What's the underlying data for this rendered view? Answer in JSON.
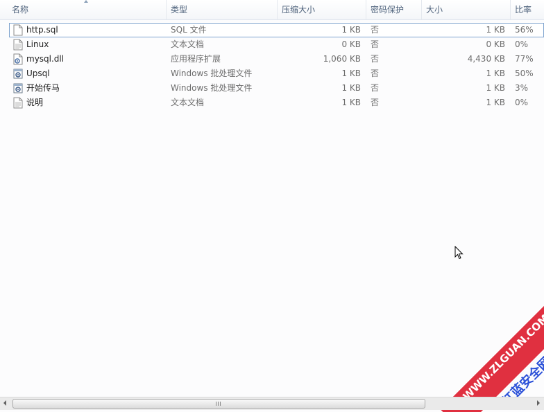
{
  "columns": {
    "name": "名称",
    "type": "类型",
    "compressed": "压缩大小",
    "password": "密码保护",
    "size": "大小",
    "ratio": "比率"
  },
  "files": [
    {
      "name": "http.sql",
      "type": "SQL 文件",
      "compressed": "1 KB",
      "password": "否",
      "size": "1 KB",
      "ratio": "56%",
      "icon": "document-icon",
      "selected": true
    },
    {
      "name": "Linux",
      "type": "文本文档",
      "compressed": "0 KB",
      "password": "否",
      "size": "0 KB",
      "ratio": "0%",
      "icon": "text-file-icon"
    },
    {
      "name": "mysql.dll",
      "type": "应用程序扩展",
      "compressed": "1,060 KB",
      "password": "否",
      "size": "4,430 KB",
      "ratio": "77%",
      "icon": "dll-gear-icon"
    },
    {
      "name": "Upsql",
      "type": "Windows 批处理文件",
      "compressed": "1 KB",
      "password": "否",
      "size": "1 KB",
      "ratio": "50%",
      "icon": "batch-file-icon"
    },
    {
      "name": "开始传马",
      "type": "Windows 批处理文件",
      "compressed": "1 KB",
      "password": "否",
      "size": "1 KB",
      "ratio": "3%",
      "icon": "batch-file-icon"
    },
    {
      "name": "说明",
      "type": "文本文档",
      "compressed": "1 KB",
      "password": "否",
      "size": "1 KB",
      "ratio": "0%",
      "icon": "text-file-icon"
    }
  ],
  "watermark": {
    "url": "WWW.ZLGUAN.COM",
    "text": "红蓝安全网"
  },
  "colors": {
    "header_text": "#4c607a",
    "selection_border": "#7da2ce",
    "watermark_red": "#e03040",
    "watermark_blue": "#2a50d8"
  }
}
